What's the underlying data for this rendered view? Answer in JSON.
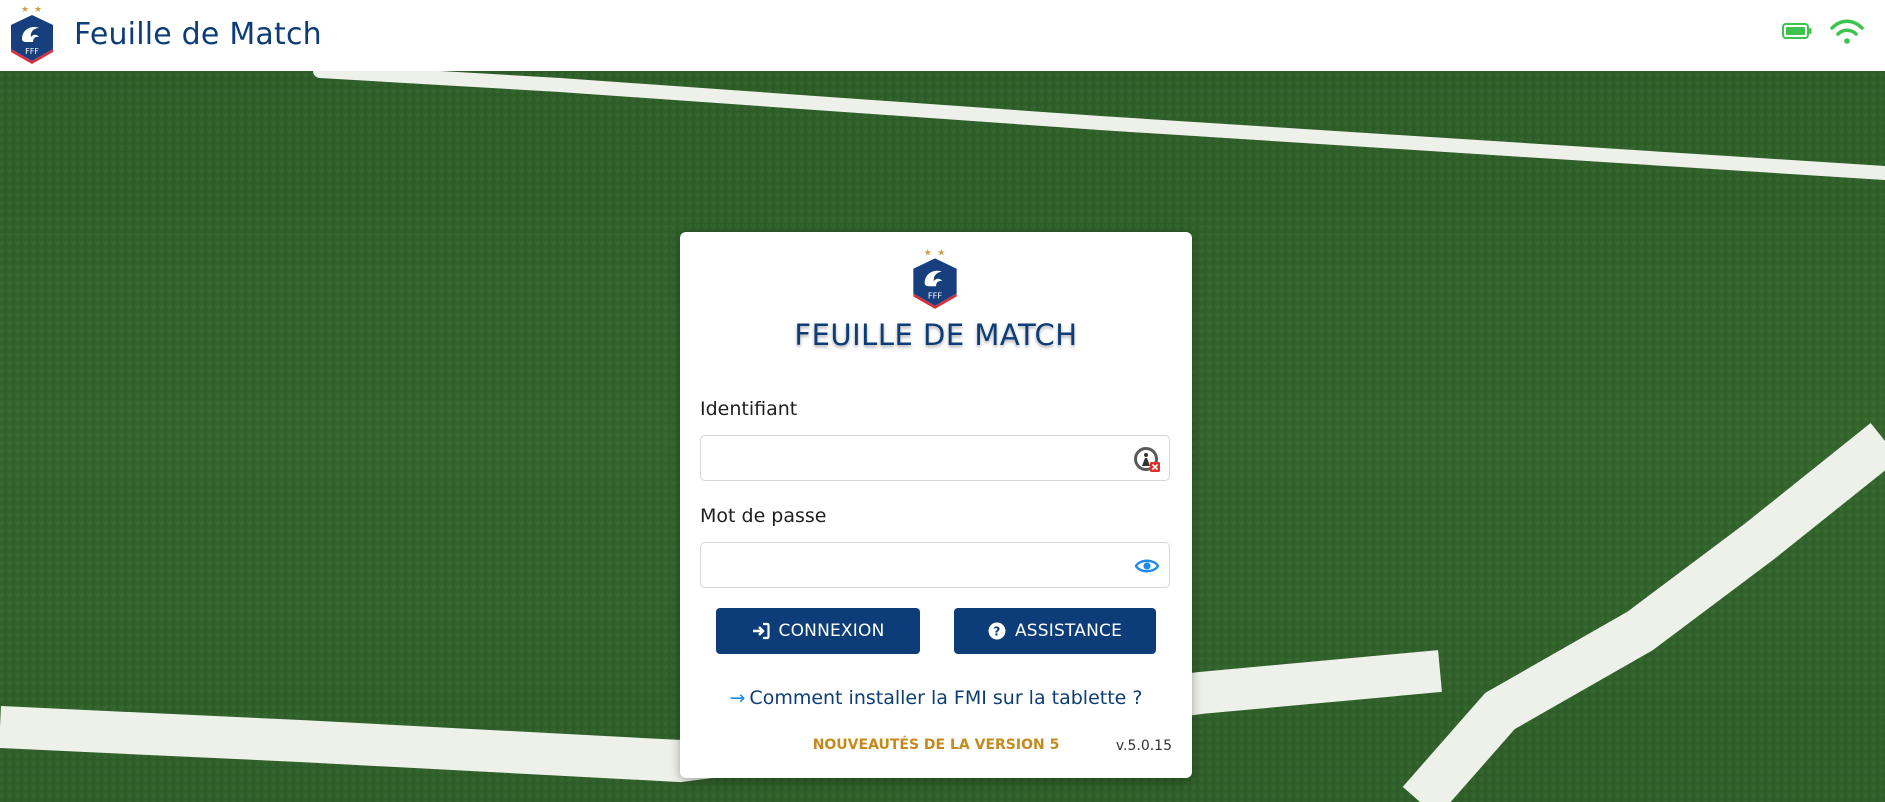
{
  "header": {
    "app_title": "Feuille de Match",
    "logo_text": "FFF",
    "battery_icon": "battery-full-icon",
    "wifi_icon": "wifi-icon",
    "status_color": "#3cc44f"
  },
  "login": {
    "title": "FEUILLE DE MATCH",
    "logo_text": "FFF",
    "username_label": "Identifiant",
    "username_value": "",
    "username_icon": "keychain-autofill-icon",
    "password_label": "Mot de passe",
    "password_value": "",
    "password_icon": "eye-icon",
    "connect_label": "CONNEXION",
    "assistance_label": "ASSISTANCE",
    "install_link": "Comment installer la FMI sur la tablette ?",
    "news_link": "NOUVEAUTÉS DE LA VERSION 5",
    "version": "v.5.0.15"
  },
  "colors": {
    "brand_blue": "#0d3d78",
    "accent_gold": "#c48a1c",
    "link_arrow": "#1e8be8"
  }
}
